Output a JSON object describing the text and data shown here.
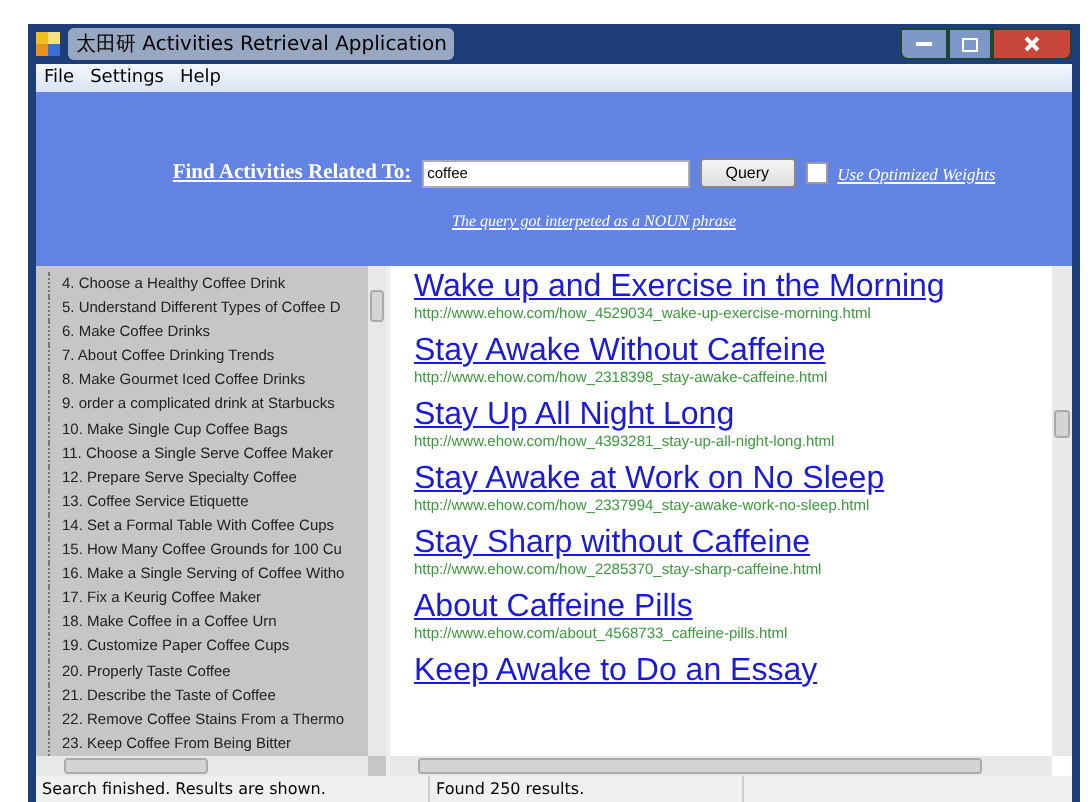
{
  "window": {
    "title": "太田研 Activities Retrieval Application"
  },
  "menu": [
    "File",
    "Settings",
    "Help"
  ],
  "search": {
    "label": "Find Activities Related To:",
    "value": "coffee",
    "button": "Query",
    "optimized": {
      "label": "Use Optimized Weights",
      "checked": false
    },
    "interpretation": "The query got interpeted as a NOUN phrase"
  },
  "activities": [
    "4. Choose a Healthy Coffee Drink",
    "5. Understand Different Types of Coffee D",
    "6. Make Coffee Drinks",
    "7. About Coffee Drinking Trends",
    "8. Make Gourmet Iced Coffee Drinks",
    "9. order a complicated drink at Starbucks",
    "10. Make Single Cup Coffee Bags",
    "11. Choose a Single Serve Coffee Maker",
    "12. Prepare  Serve Specialty Coffee",
    "13. Coffee Service Etiquette",
    "14. Set a Formal Table With Coffee Cups",
    "15. How Many Coffee Grounds for 100 Cu",
    "16. Make a Single Serving of Coffee Witho",
    "17. Fix a Keurig Coffee Maker",
    "18. Make Coffee in a Coffee Urn",
    "19. Customize Paper Coffee Cups",
    "20. Properly Taste Coffee",
    "21. Describe the Taste of Coffee",
    "22. Remove Coffee Stains From a Thermo",
    "23. Keep Coffee From Being Bitter"
  ],
  "results": [
    {
      "title": "Wake up and Exercise in the Morning",
      "url": "http://www.ehow.com/how_4529034_wake-up-exercise-morning.html"
    },
    {
      "title": "Stay Awake Without Caffeine",
      "url": "http://www.ehow.com/how_2318398_stay-awake-caffeine.html"
    },
    {
      "title": "Stay Up All Night Long",
      "url": "http://www.ehow.com/how_4393281_stay-up-all-night-long.html"
    },
    {
      "title": "Stay Awake at Work on No Sleep",
      "url": "http://www.ehow.com/how_2337994_stay-awake-work-no-sleep.html"
    },
    {
      "title": "Stay Sharp without Caffeine",
      "url": "http://www.ehow.com/how_2285370_stay-sharp-caffeine.html"
    },
    {
      "title": "About Caffeine Pills",
      "url": "http://www.ehow.com/about_4568733_caffeine-pills.html"
    },
    {
      "title": "Keep Awake to Do an Essay"
    }
  ],
  "status_bar": [
    "Search finished.  Results are shown.",
    "Found 250 results."
  ]
}
